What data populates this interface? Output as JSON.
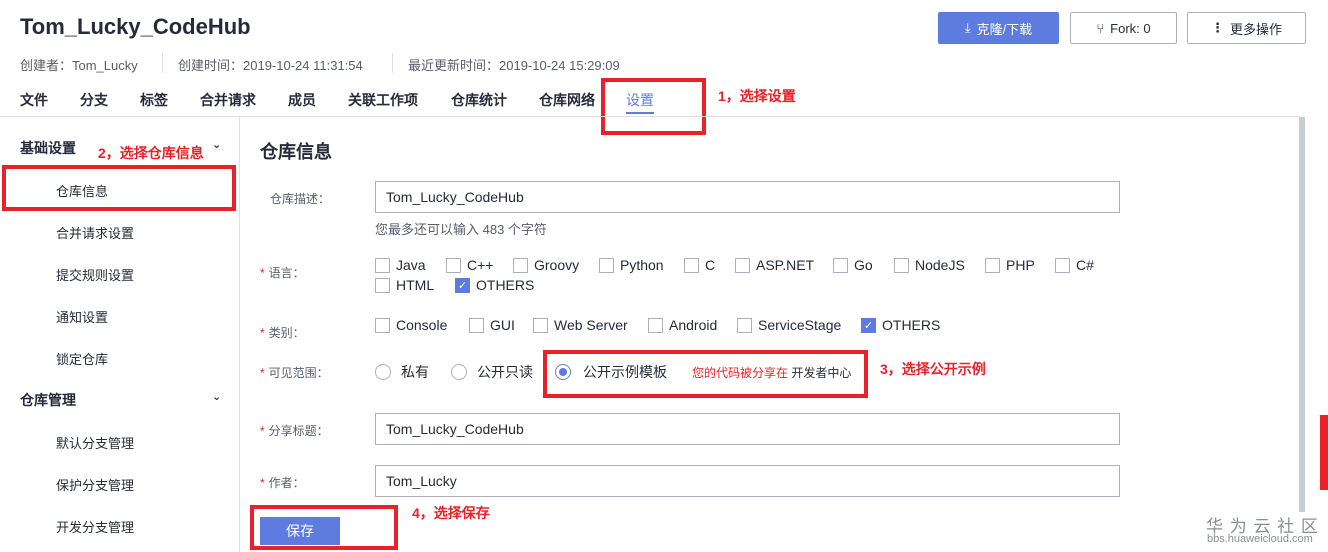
{
  "header": {
    "title": "Tom_Lucky_CodeHub",
    "creator": "创建者：Tom_Lucky",
    "created": "创建时间：2019-10-24 11:31:54",
    "updated": "最近更新时间：2019-10-24 15:29:09",
    "clone_label": "克隆/下载",
    "fork_label": "Fork: 0",
    "more_label": "更多操作"
  },
  "tabs": [
    "文件",
    "分支",
    "标签",
    "合并请求",
    "成员",
    "关联工作项",
    "仓库统计",
    "仓库网络",
    "设置"
  ],
  "sidebar": {
    "group1": "基础设置",
    "items1": [
      "仓库信息",
      "合并请求设置",
      "提交规则设置",
      "通知设置",
      "锁定仓库"
    ],
    "group2": "仓库管理",
    "items2": [
      "默认分支管理",
      "保护分支管理",
      "开发分支管理"
    ]
  },
  "main": {
    "title": "仓库信息",
    "desc_label": "仓库描述：",
    "desc_value": "Tom_Lucky_CodeHub",
    "desc_hint": "您最多还可以输入 483 个字符",
    "lang_label": "语言：",
    "languages": [
      {
        "name": "Java",
        "checked": false
      },
      {
        "name": "C++",
        "checked": false
      },
      {
        "name": "Groovy",
        "checked": false
      },
      {
        "name": "Python",
        "checked": false
      },
      {
        "name": "C",
        "checked": false
      },
      {
        "name": "ASP.NET",
        "checked": false
      },
      {
        "name": "Go",
        "checked": false
      },
      {
        "name": "NodeJS",
        "checked": false
      },
      {
        "name": "PHP",
        "checked": false
      },
      {
        "name": "C#",
        "checked": false
      },
      {
        "name": "HTML",
        "checked": false
      },
      {
        "name": "OTHERS",
        "checked": true
      }
    ],
    "cat_label": "类别：",
    "categories": [
      {
        "name": "Console",
        "checked": false
      },
      {
        "name": "GUI",
        "checked": false
      },
      {
        "name": "Web Server",
        "checked": false
      },
      {
        "name": "Android",
        "checked": false
      },
      {
        "name": "ServiceStage",
        "checked": false
      },
      {
        "name": "OTHERS",
        "checked": true
      }
    ],
    "vis_label": "可见范围：",
    "vis_options": [
      "私有",
      "公开只读",
      "公开示例模板"
    ],
    "vis_selected": 2,
    "vis_note_red": "您的代码被分享在",
    "vis_note_link": "开发者中心",
    "share_label": "分享标题：",
    "share_value": "Tom_Lucky_CodeHub",
    "author_label": "作者：",
    "author_value": "Tom_Lucky",
    "save_label": "保存",
    "required": "*"
  },
  "annotations": [
    "1，选择设置",
    "2，选择仓库信息",
    "3，选择公开示例",
    "4，选择保存"
  ],
  "watermark": {
    "cn": "华 为 云 社 区",
    "url": "bbs.huaweicloud.com"
  }
}
